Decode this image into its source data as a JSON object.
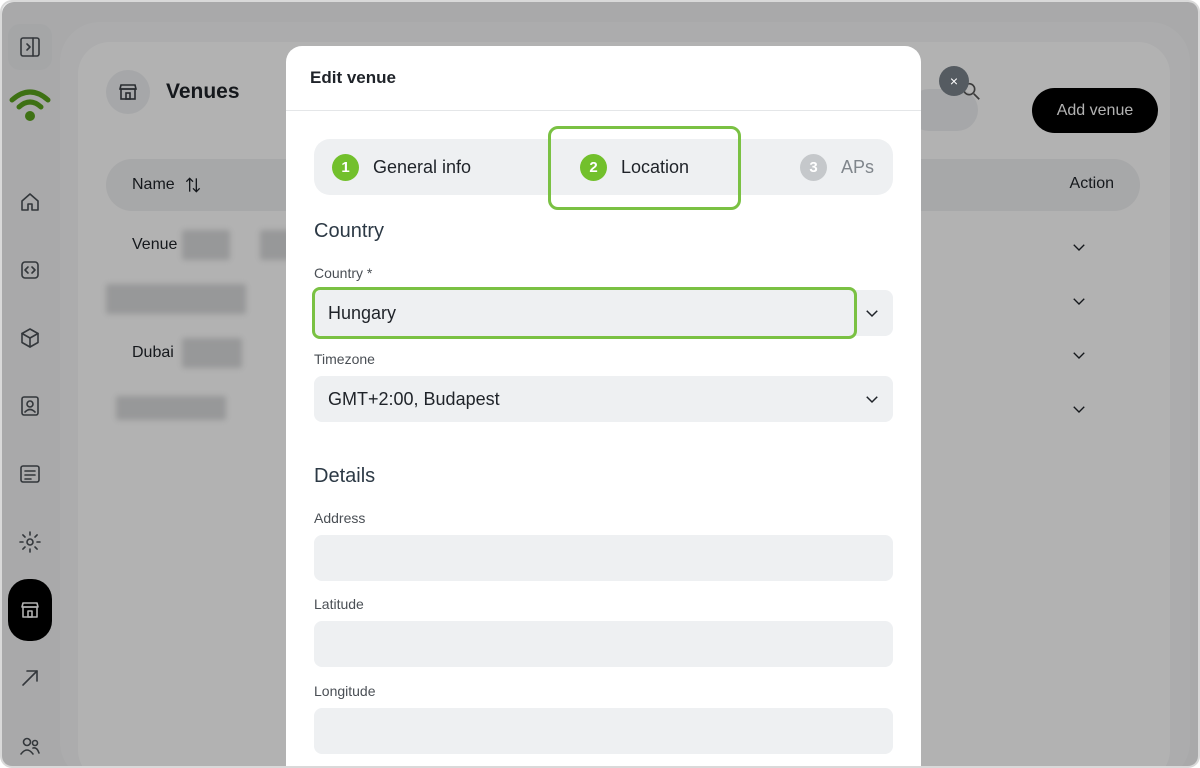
{
  "background": {
    "page_title": "Venues",
    "add_button_label": "Add venue",
    "clear_label": "×",
    "columns": {
      "name": "Name",
      "action": "Action"
    },
    "rows": [
      {
        "name": "Venue"
      },
      {
        "name": ""
      },
      {
        "name": "Dubai"
      },
      {
        "name": ""
      }
    ]
  },
  "modal": {
    "title": "Edit venue",
    "steps": [
      {
        "num": "1",
        "label": "General info"
      },
      {
        "num": "2",
        "label": "Location"
      },
      {
        "num": "3",
        "label": "APs"
      }
    ],
    "location_section": "Country",
    "country_label": "Country *",
    "country_value": "Hungary",
    "timezone_label": "Timezone",
    "timezone_value": "GMT+2:00, Budapest",
    "details_section": "Details",
    "address_label": "Address",
    "latitude_label": "Latitude",
    "longitude_label": "Longitude"
  },
  "colors": {
    "accent": "#72c02c",
    "highlight": "#7ac143",
    "primary_button": "#000000"
  }
}
